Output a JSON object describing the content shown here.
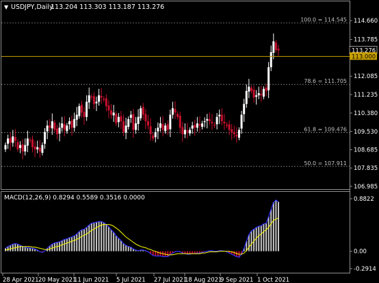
{
  "header": {
    "symbol": "USDJPY,Daily",
    "ohlc": "113.204 113.303 113.187 113.276"
  },
  "price_axis": {
    "ticks": [
      "114.660",
      "113.785",
      "112.085",
      "111.235",
      "110.380",
      "109.530",
      "108.685",
      "107.835",
      "106.985"
    ],
    "current_price_label": "113.276",
    "hline_label": "113.000"
  },
  "fib_levels": [
    {
      "label": "100.0 = 114.545"
    },
    {
      "label": "78.6 = 111.705"
    },
    {
      "label": "61.8 = 109.476"
    },
    {
      "label": "50.0 = 107.911"
    }
  ],
  "indicator": {
    "label": "MACD(12,26,9) 0.8294 0.5589 0.3516 0.0000",
    "ticks": [
      "0.8822",
      "0.00",
      "-0.2914"
    ]
  },
  "time_axis": {
    "labels": [
      "28 Apr 2021",
      "20 May 2021",
      "11 Jun 2021",
      "5 Jul 2021",
      "27 Jul 2021",
      "18 Aug 2021",
      "9 Sep 2021",
      "1 Oct 2021"
    ]
  },
  "colors": {
    "background": "#000000",
    "grid": "#808080",
    "bull_candle": "#ffffff",
    "bear_candle": "#c8102e",
    "hline": "#c8a000",
    "macd_line": "#3333ff",
    "signal_line": "#ffff00"
  },
  "chart_data": [
    {
      "type": "candlestick",
      "title": "USDJPY,Daily",
      "ylim": [
        106.985,
        114.66
      ],
      "x_start": "2021-04-26",
      "horizontal_line": 113.0,
      "fib_retracement": [
        114.545,
        111.705,
        109.476,
        107.911
      ],
      "closes": [
        108.9,
        109.2,
        109.0,
        109.3,
        109.1,
        108.7,
        108.9,
        108.6,
        108.9,
        109.2,
        109.1,
        108.8,
        108.7,
        108.8,
        108.6,
        108.9,
        109.5,
        109.8,
        109.7,
        110.0,
        109.6,
        109.4,
        109.7,
        109.9,
        109.6,
        109.8,
        110.0,
        109.7,
        110.1,
        110.3,
        110.7,
        110.4,
        110.2,
        110.9,
        111.2,
        111.1,
        110.8,
        110.9,
        111.2,
        111.1,
        111.0,
        110.7,
        110.5,
        110.3,
        110.4,
        109.9,
        110.2,
        110.0,
        109.5,
        109.8,
        110.1,
        110.3,
        109.6,
        109.9,
        110.2,
        110.6,
        110.3,
        110.0,
        109.8,
        109.4,
        109.2,
        109.5,
        109.7,
        109.9,
        109.6,
        109.8,
        109.6,
        110.3,
        110.6,
        110.4,
        110.2,
        109.7,
        109.4,
        109.6,
        109.5,
        109.6,
        109.8,
        109.7,
        109.9,
        109.8,
        109.9,
        110.0,
        110.1,
        110.0,
        109.9,
        109.8,
        110.2,
        110.3,
        110.0,
        109.9,
        109.8,
        109.6,
        109.5,
        109.4,
        109.3,
        109.6,
        110.3,
        110.8,
        111.4,
        111.6,
        111.4,
        111.1,
        111.2,
        111.3,
        111.2,
        111.5,
        111.4,
        112.5,
        113.2,
        113.7,
        113.3,
        113.276
      ]
    },
    {
      "type": "bar",
      "title": "MACD(12,26,9)",
      "ylim": [
        -0.2914,
        0.8822
      ],
      "series": [
        {
          "name": "MACD",
          "values": [
            0.05,
            0.08,
            0.1,
            0.12,
            0.13,
            0.12,
            0.1,
            0.08,
            0.07,
            0.06,
            0.06,
            0.05,
            0.04,
            0.02,
            -0.01,
            -0.02,
            0.0,
            0.05,
            0.09,
            0.12,
            0.14,
            0.15,
            0.16,
            0.18,
            0.2,
            0.21,
            0.23,
            0.24,
            0.26,
            0.29,
            0.33,
            0.36,
            0.37,
            0.4,
            0.44,
            0.47,
            0.48,
            0.49,
            0.5,
            0.5,
            0.48,
            0.45,
            0.41,
            0.36,
            0.32,
            0.26,
            0.22,
            0.18,
            0.13,
            0.1,
            0.08,
            0.07,
            0.04,
            0.02,
            0.01,
            0.02,
            0.02,
            0.01,
            -0.01,
            -0.04,
            -0.07,
            -0.08,
            -0.08,
            -0.08,
            -0.09,
            -0.09,
            -0.09,
            -0.06,
            -0.03,
            -0.01,
            0.0,
            -0.01,
            -0.03,
            -0.04,
            -0.05,
            -0.05,
            -0.04,
            -0.04,
            -0.03,
            -0.03,
            -0.02,
            -0.01,
            0.0,
            0.01,
            0.01,
            0.0,
            0.0,
            0.01,
            0.01,
            0.0,
            -0.01,
            -0.03,
            -0.05,
            -0.07,
            -0.09,
            -0.1,
            -0.05,
            0.05,
            0.17,
            0.28,
            0.34,
            0.37,
            0.4,
            0.42,
            0.43,
            0.46,
            0.47,
            0.58,
            0.7,
            0.82,
            0.86,
            0.8294
          ]
        },
        {
          "name": "Signal",
          "values": [
            0.02,
            0.03,
            0.04,
            0.05,
            0.06,
            0.07,
            0.08,
            0.08,
            0.08,
            0.08,
            0.08,
            0.07,
            0.07,
            0.06,
            0.05,
            0.04,
            0.03,
            0.03,
            0.04,
            0.05,
            0.07,
            0.08,
            0.09,
            0.11,
            0.12,
            0.14,
            0.15,
            0.17,
            0.18,
            0.2,
            0.22,
            0.25,
            0.27,
            0.29,
            0.32,
            0.35,
            0.37,
            0.4,
            0.42,
            0.44,
            0.45,
            0.45,
            0.45,
            0.44,
            0.42,
            0.39,
            0.36,
            0.32,
            0.28,
            0.24,
            0.21,
            0.18,
            0.15,
            0.12,
            0.1,
            0.08,
            0.07,
            0.06,
            0.04,
            0.03,
            0.01,
            0.0,
            -0.02,
            -0.03,
            -0.04,
            -0.05,
            -0.06,
            -0.06,
            -0.06,
            -0.05,
            -0.04,
            -0.04,
            -0.04,
            -0.04,
            -0.04,
            -0.04,
            -0.04,
            -0.04,
            -0.04,
            -0.04,
            -0.03,
            -0.03,
            -0.02,
            -0.01,
            -0.01,
            -0.01,
            -0.01,
            0.0,
            0.0,
            0.0,
            0.0,
            0.0,
            -0.01,
            -0.02,
            -0.04,
            -0.05,
            -0.05,
            -0.03,
            0.01,
            0.07,
            0.12,
            0.17,
            0.22,
            0.26,
            0.29,
            0.33,
            0.36,
            0.4,
            0.46,
            0.52,
            0.54,
            0.5589
          ]
        }
      ]
    }
  ]
}
